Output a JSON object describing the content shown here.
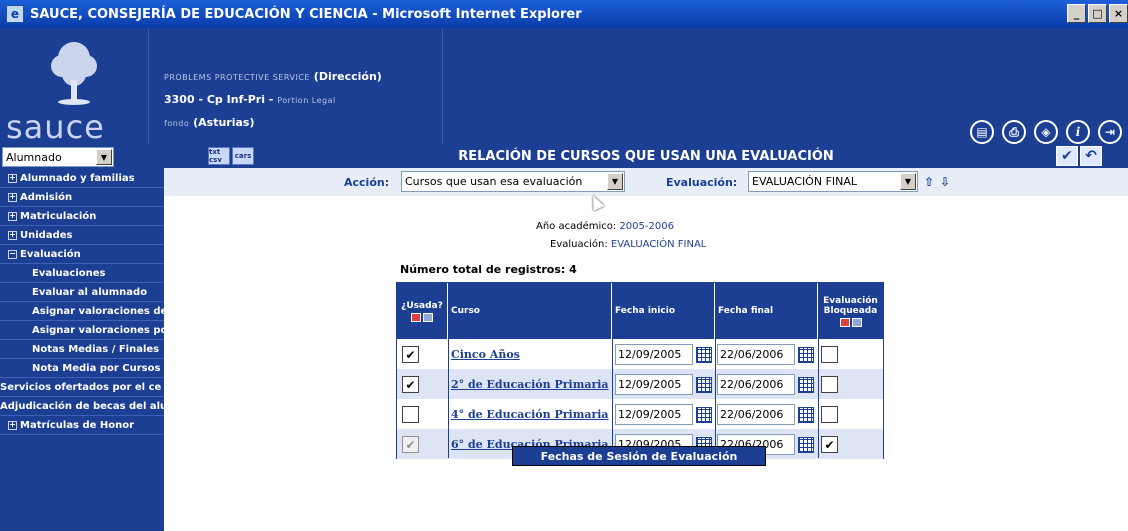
{
  "window": {
    "title": "SAUCE, CONSEJERÍA DE EDUCACIÓN Y CIENCIA - Microsoft Internet Explorer",
    "min_label": "_",
    "max_label": "□",
    "close_label": "×"
  },
  "header": {
    "logo_text": "sauce",
    "school_line1_blur": "PROBLEMS PROTECTIVE SERVICE",
    "school_line1_tail": "(Dirección)",
    "school_line2_code": "3300",
    "school_line2_type": "- Cp Inf-Pri -",
    "school_line2_blur": "Portion Legal",
    "school_line3_blur": "fondo",
    "school_line3_tail": "(Asturias)",
    "icons": [
      "document-icon",
      "print-icon",
      "navigate-icon",
      "info-icon",
      "exit-icon"
    ]
  },
  "sidebar": {
    "role": "Alumnado",
    "items": [
      {
        "label": "Alumnado y familias",
        "type": "group"
      },
      {
        "label": "Admisión",
        "type": "group"
      },
      {
        "label": "Matriculación",
        "type": "group"
      },
      {
        "label": "Unidades",
        "type": "group"
      },
      {
        "label": "Evaluación",
        "type": "group-open"
      },
      {
        "label": "Evaluaciones",
        "type": "sub"
      },
      {
        "label": "Evaluar al alumnado",
        "type": "sub"
      },
      {
        "label": "Asignar valoraciones de",
        "type": "sub"
      },
      {
        "label": "Asignar valoraciones por",
        "type": "sub"
      },
      {
        "label": "Notas Medias / Finales",
        "type": "sub"
      },
      {
        "label": "Nota Media por Cursos",
        "type": "sub"
      },
      {
        "label": "Servicios ofertados por el ce",
        "type": "plain"
      },
      {
        "label": "Adjudicación de becas del alu",
        "type": "plain"
      },
      {
        "label": "Matrículas de Honor",
        "type": "group"
      }
    ]
  },
  "content": {
    "title": "RELACIÓN DE CURSOS QUE USAN UNA EVALUACIÓN",
    "tool_icon_1": "txt csv",
    "tool_icon_2": "cars",
    "accept_label": "✔",
    "undo_label": "↶",
    "accion_label": "Acción:",
    "accion_value": "Cursos que usan esa evaluación",
    "evaluacion_label": "Evaluación:",
    "evaluacion_value": "EVALUACIÓN FINAL",
    "nav_up": "⇧",
    "nav_down": "⇩",
    "anio_label": "Año académico:",
    "anio_value": "2005-2006",
    "eval_info_label": "Evaluación:",
    "eval_info_value": "EVALUACIÓN FINAL",
    "total_label": "Número total de registros: 4"
  },
  "table": {
    "headers": {
      "usada": "¿Usada?",
      "curso": "Curso",
      "fecha_inicio": "Fecha inicio",
      "fecha_final": "Fecha final",
      "bloqueada": "Evaluación Bloqueada"
    },
    "rows": [
      {
        "usada": true,
        "usada_disabled": false,
        "curso": "Cinco Años",
        "inicio": "12/09/2005",
        "final": "22/06/2006",
        "bloqueada": false
      },
      {
        "usada": true,
        "usada_disabled": false,
        "curso": "2° de Educación Primaria",
        "inicio": "12/09/2005",
        "final": "22/06/2006",
        "bloqueada": false
      },
      {
        "usada": false,
        "usada_disabled": false,
        "curso": "4° de Educación Primaria",
        "inicio": "12/09/2005",
        "final": "22/06/2006",
        "bloqueada": false
      },
      {
        "usada": true,
        "usada_disabled": true,
        "curso": "6° de Educación Primaria",
        "inicio": "12/09/2005",
        "final": "22/06/2006",
        "bloqueada": true
      }
    ]
  },
  "tooltip": "Fechas de Sesión de Evaluación"
}
